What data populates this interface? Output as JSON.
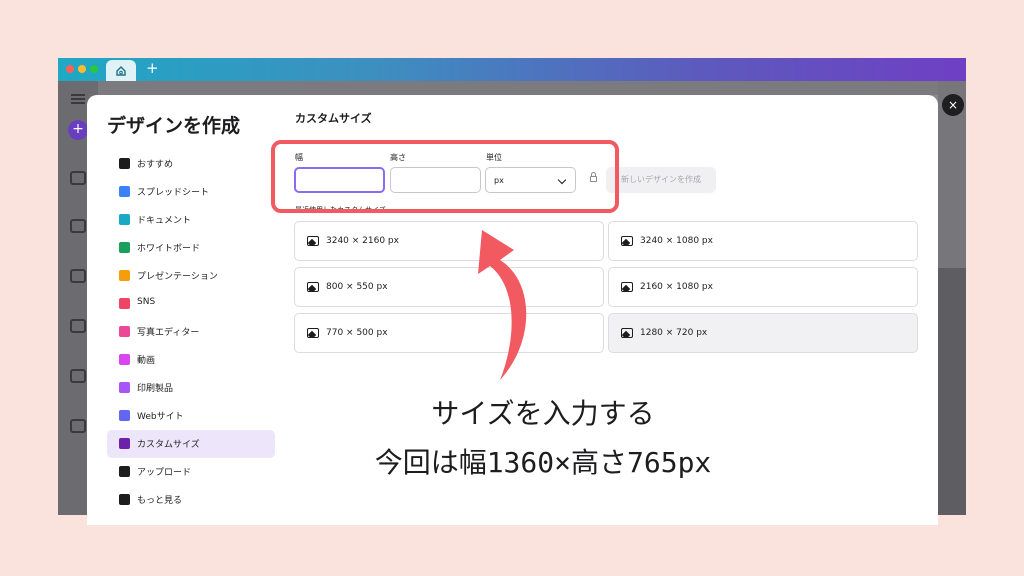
{
  "modal": {
    "title": "デザインを作成",
    "close_label": "×"
  },
  "nav": {
    "items": [
      {
        "label": "おすすめ",
        "icon": "sparkle-icon",
        "color": "#1d1d1f"
      },
      {
        "label": "スプレッドシート",
        "icon": "spreadsheet-icon",
        "color": "#3b82f6"
      },
      {
        "label": "ドキュメント",
        "icon": "document-icon",
        "color": "#17a9c6"
      },
      {
        "label": "ホワイトボード",
        "icon": "whiteboard-icon",
        "color": "#1aa05a"
      },
      {
        "label": "プレゼンテーション",
        "icon": "presentation-icon",
        "color": "#f59e0b"
      },
      {
        "label": "SNS",
        "icon": "heart-icon",
        "color": "#ef4466"
      },
      {
        "label": "写真エディター",
        "icon": "camera-icon",
        "color": "#ec4899"
      },
      {
        "label": "動画",
        "icon": "video-icon",
        "color": "#d946ef"
      },
      {
        "label": "印刷製品",
        "icon": "printer-icon",
        "color": "#a855f7"
      },
      {
        "label": "Webサイト",
        "icon": "website-icon",
        "color": "#6366f1"
      },
      {
        "label": "カスタムサイズ",
        "icon": "crop-icon",
        "color": "#6b21a8",
        "active": true
      },
      {
        "label": "アップロード",
        "icon": "upload-cloud-icon",
        "color": "#1d1d1f"
      },
      {
        "label": "もっと見る",
        "icon": "more-dots-icon",
        "color": "#1d1d1f"
      }
    ]
  },
  "custom": {
    "title": "カスタムサイズ",
    "width_label": "幅",
    "width_value": "",
    "height_label": "高さ",
    "height_value": "",
    "unit_label": "単位",
    "unit_value": "px",
    "create_button": "新しいデザインを作成",
    "recent_label": "最近使用したカスタムサイズ"
  },
  "recent_sizes": [
    "3240 × 2160 px",
    "3240 × 1080 px",
    "800 × 550 px",
    "2160 × 1080 px",
    "770 × 500 px",
    "1280 × 720 px"
  ],
  "annotation": {
    "line1": "サイズを入力する",
    "line2": "今回は幅1360×高さ765px"
  },
  "colors": {
    "accent": "#8b6cf0",
    "highlight": "#f15a61",
    "background": "#f9e3dc"
  }
}
